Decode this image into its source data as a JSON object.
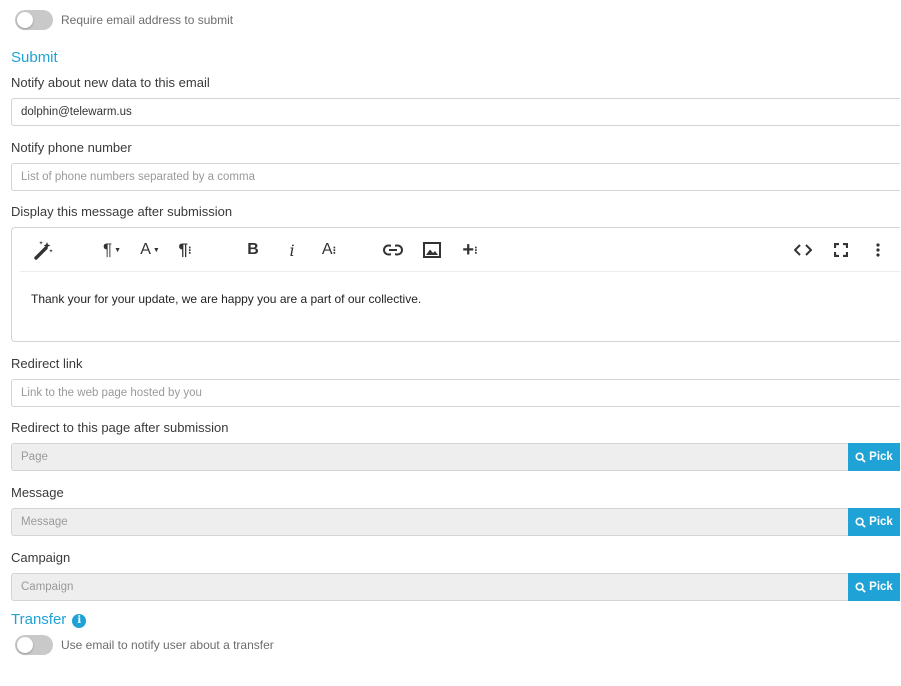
{
  "require_email": {
    "label": "Require email address to submit",
    "enabled": false
  },
  "submit_section": {
    "title": "Submit"
  },
  "notify_email": {
    "label": "Notify about new data to this email",
    "value": "dolphin@telewarm.us"
  },
  "notify_phone": {
    "label": "Notify phone number",
    "placeholder": "List of phone numbers separated by a comma"
  },
  "display_message": {
    "label": "Display this message after submission",
    "content": "Thank your for your update, we are happy you are a part of our collective.",
    "toolbar": {
      "magic": "magic-wand-icon",
      "paragraph_format": "paragraph-format-icon",
      "font_size": "font-size-icon",
      "paragraph_style": "paragraph-style-icon",
      "bold": "B",
      "italic": "i",
      "text_style": "text-style-icon",
      "link": "link-icon",
      "image": "image-icon",
      "insert": "insert-plus-icon",
      "code_view": "code-view-icon",
      "fullscreen": "fullscreen-icon",
      "more": "more-vertical-icon"
    }
  },
  "redirect_link": {
    "label": "Redirect link",
    "placeholder": "Link to the web page hosted by you"
  },
  "redirect_page": {
    "label": "Redirect to this page after submission",
    "placeholder": "Page",
    "button": "Pick"
  },
  "message": {
    "label": "Message",
    "placeholder": "Message",
    "button": "Pick"
  },
  "campaign": {
    "label": "Campaign",
    "placeholder": "Campaign",
    "button": "Pick"
  },
  "transfer_section": {
    "title": "Transfer",
    "info_icon": "info-icon"
  },
  "transfer_notify": {
    "label": "Use email to notify user about a transfer",
    "enabled": false
  },
  "colors": {
    "accent": "#1fa2d6",
    "toggle_off": "#c9c9c9",
    "disabled_input": "#eeeeee"
  }
}
